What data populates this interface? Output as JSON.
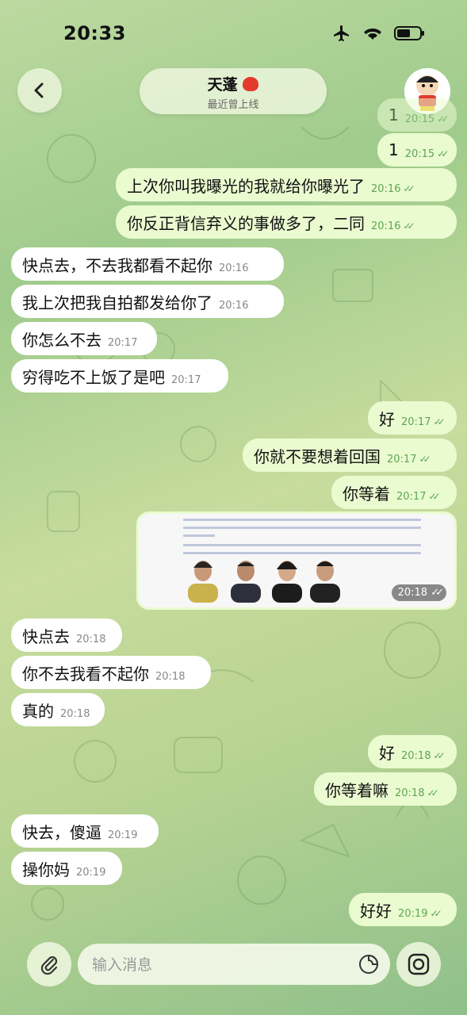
{
  "status_bar": {
    "time": "20:33"
  },
  "header": {
    "contact_name": "天蓬",
    "contact_status": "最近曾上线"
  },
  "input": {
    "placeholder": "输入消息"
  },
  "messages": [
    {
      "dir": "out",
      "text": "1",
      "time": "20:15"
    },
    {
      "dir": "out",
      "text": "1",
      "time": "20:15"
    },
    {
      "dir": "out",
      "text": "上次你叫我曝光的我就给你曝光了",
      "time": "20:16"
    },
    {
      "dir": "out",
      "text": "你反正背信弃义的事做多了，二同",
      "time": "20:16"
    },
    {
      "dir": "in",
      "text": "快点去，不去我都看不起你",
      "time": "20:16"
    },
    {
      "dir": "in",
      "text": "我上次把我自拍都发给你了",
      "time": "20:16"
    },
    {
      "dir": "in",
      "text": "你怎么不去",
      "time": "20:17"
    },
    {
      "dir": "in",
      "text": "穷得吃不上饭了是吧",
      "time": "20:17"
    },
    {
      "dir": "out",
      "text": "好",
      "time": "20:17"
    },
    {
      "dir": "out",
      "text": "你就不要想着回国",
      "time": "20:17"
    },
    {
      "dir": "out",
      "text": "你等着",
      "time": "20:17"
    },
    {
      "dir": "out",
      "type": "photo",
      "time": "20:18"
    },
    {
      "dir": "in",
      "text": "快点去",
      "time": "20:18"
    },
    {
      "dir": "in",
      "text": "你不去我看不起你",
      "time": "20:18"
    },
    {
      "dir": "in",
      "text": "真的",
      "time": "20:18"
    },
    {
      "dir": "out",
      "text": "好",
      "time": "20:18"
    },
    {
      "dir": "out",
      "text": "你等着嘛",
      "time": "20:18"
    },
    {
      "dir": "in",
      "text": "快去，傻逼",
      "time": "20:19"
    },
    {
      "dir": "in",
      "text": "操你妈",
      "time": "20:19"
    },
    {
      "dir": "out",
      "text": "好好",
      "time": "20:19"
    }
  ],
  "icons": {
    "back": "chevron-left-icon",
    "attach": "paperclip-icon",
    "sticker": "sticker-icon",
    "camera": "camera-icon"
  },
  "colors": {
    "outgoing_bubble": "#eafbd0",
    "incoming_bubble": "#ffffff",
    "accent": "#5ea553"
  }
}
